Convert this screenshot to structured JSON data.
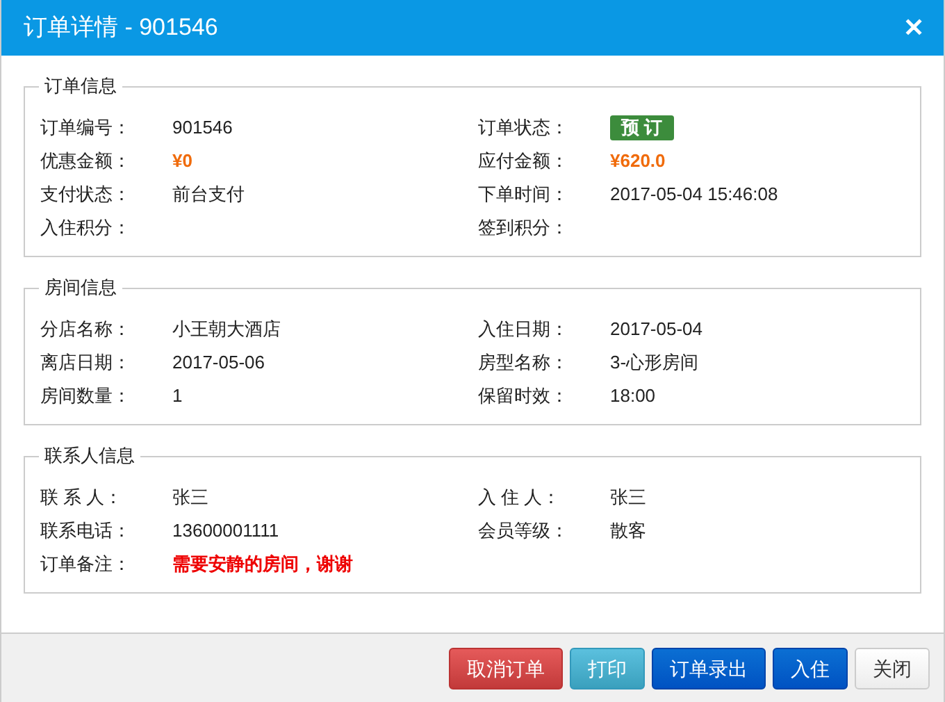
{
  "window": {
    "title": "订单详情 - 901546",
    "close": "✕"
  },
  "sections": [
    {
      "title": "订单信息",
      "fields": [
        {
          "label": "订单编号：",
          "value": "901546",
          "kind": "text"
        },
        {
          "label": "订单状态：",
          "value": "预 订",
          "kind": "badge"
        },
        {
          "label": "优惠金额：",
          "value": "¥0",
          "kind": "price"
        },
        {
          "label": "应付金额：",
          "value": "¥620.0",
          "kind": "price"
        },
        {
          "label": "支付状态：",
          "value": "前台支付",
          "kind": "text"
        },
        {
          "label": "下单时间：",
          "value": "2017-05-04 15:46:08",
          "kind": "text"
        },
        {
          "label": "入住积分："
        },
        {
          "label": "签到积分："
        }
      ]
    },
    {
      "title": "房间信息",
      "fields": [
        {
          "label": "分店名称：",
          "value": "小王朝大酒店",
          "kind": "text"
        },
        {
          "label": "入住日期：",
          "value": "2017-05-04",
          "kind": "text"
        },
        {
          "label": "离店日期：",
          "value": "2017-05-06",
          "kind": "text"
        },
        {
          "label": "房型名称：",
          "value": "3-心形房间",
          "kind": "text"
        },
        {
          "label": "房间数量：",
          "value": "1",
          "kind": "text"
        },
        {
          "label": "保留时效：",
          "value": "18:00",
          "kind": "text"
        }
      ]
    },
    {
      "title": "联系人信息",
      "fields": [
        {
          "label": "联 系 人：",
          "value": "张三",
          "kind": "text"
        },
        {
          "label": "入 住 人：",
          "value": "张三",
          "kind": "text"
        },
        {
          "label": "联系电话：",
          "value": "13600001111",
          "kind": "text"
        },
        {
          "label": "会员等级：",
          "value": "散客",
          "kind": "text"
        },
        {
          "label": "订单备注：",
          "value": "需要安静的房间，谢谢",
          "kind": "alert"
        }
      ]
    }
  ],
  "buttons": [
    {
      "label": "取消订单",
      "kind": "danger"
    },
    {
      "label": "打印",
      "kind": "info"
    },
    {
      "label": "订单录出",
      "kind": "primary"
    },
    {
      "label": "入住",
      "kind": "primary"
    },
    {
      "label": "关闭",
      "kind": "default"
    }
  ]
}
